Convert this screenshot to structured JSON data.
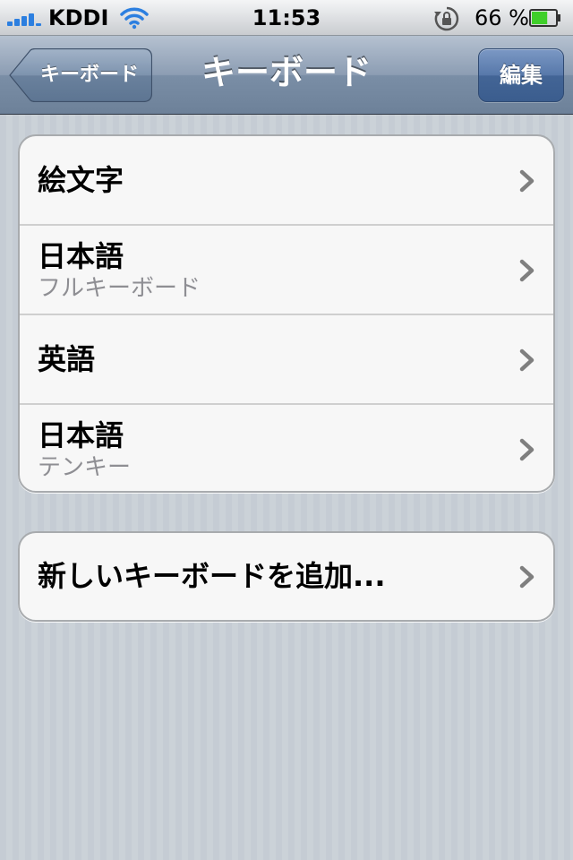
{
  "status_bar": {
    "carrier": "KDDI",
    "time": "11:53",
    "battery_percent": "66 %",
    "icons": [
      "signal-bars-icon",
      "wifi-icon",
      "rotation-lock-icon",
      "battery-icon"
    ],
    "battery_level": 0.66,
    "accent_color": "#2c7fe0",
    "battery_color": "#3fcf2a"
  },
  "nav_bar": {
    "back_label": "キーボード",
    "title": "キーボード",
    "edit_label": "編集"
  },
  "keyboards": [
    {
      "title": "絵文字",
      "subtitle": ""
    },
    {
      "title": "日本語",
      "subtitle": "フルキーボード"
    },
    {
      "title": "英語",
      "subtitle": ""
    },
    {
      "title": "日本語",
      "subtitle": "テンキー"
    }
  ],
  "add_keyboard": {
    "title": "新しいキーボードを追加..."
  }
}
